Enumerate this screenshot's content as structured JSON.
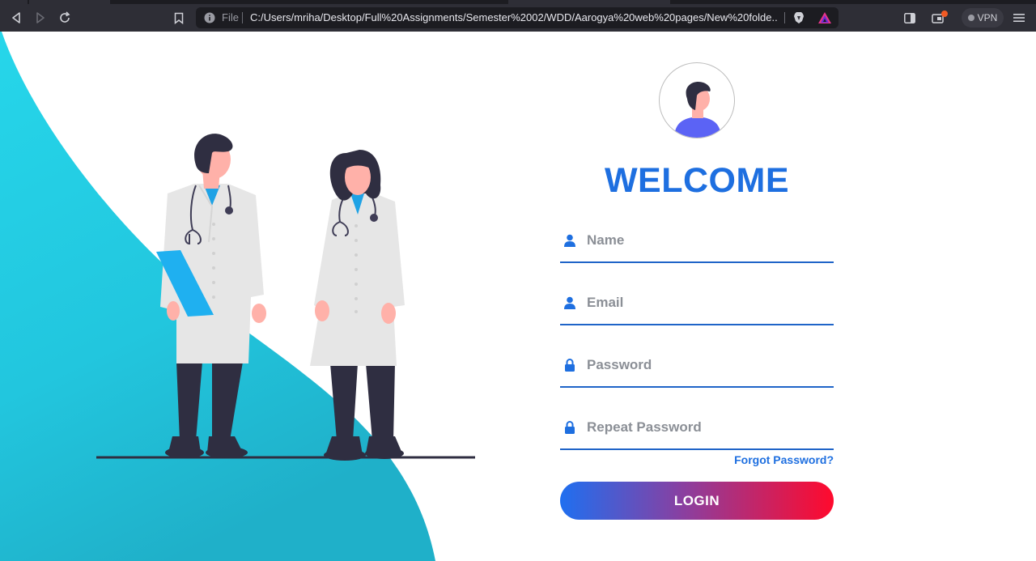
{
  "browser": {
    "file_label": "File",
    "url": "C:/Users/mriha/Desktop/Full%20Assignments/Semester%2002/WDD/Aarogya%20web%20pages/New%20folde...",
    "vpn_label": "VPN"
  },
  "page": {
    "title": "WELCOME",
    "fields": [
      {
        "placeholder": "Name",
        "icon": "user-icon"
      },
      {
        "placeholder": "Email",
        "icon": "user-icon"
      },
      {
        "placeholder": "Password",
        "icon": "lock-icon"
      },
      {
        "placeholder": "Repeat Password",
        "icon": "lock-icon"
      }
    ],
    "forgot_password": "Forgot Password?",
    "login_button": "LOGIN"
  },
  "colors": {
    "accent": "#1e6fe0",
    "wave": "#22cfe6",
    "gradient_start": "#1f6ff0",
    "gradient_end": "#ff0a2d",
    "chrome_bg": "#2e2e36"
  }
}
